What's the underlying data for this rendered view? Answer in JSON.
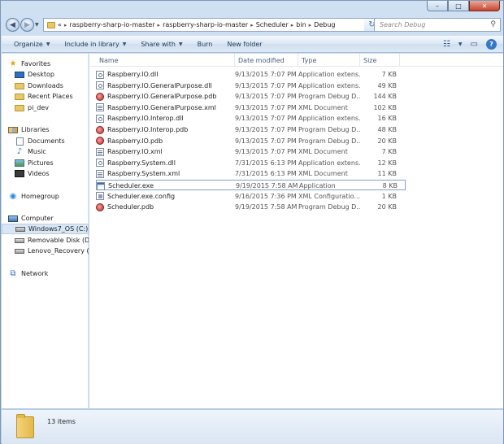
{
  "window": {
    "controls": {
      "minimize": "–",
      "maximize": "□",
      "close": "✕"
    }
  },
  "address": {
    "prefix": "«",
    "crumbs": [
      "raspberry-sharp-io-master",
      "raspberry-sharp-io-master",
      "Scheduler",
      "bin",
      "Debug"
    ],
    "separator": "▸"
  },
  "search": {
    "placeholder": "Search Debug"
  },
  "toolbar": {
    "organize": "Organize",
    "include_in_library": "Include in library",
    "share_with": "Share with",
    "burn": "Burn",
    "new_folder": "New folder"
  },
  "nav": {
    "favorites": {
      "label": "Favorites",
      "items": [
        "Desktop",
        "Downloads",
        "Recent Places",
        "pi_dev"
      ]
    },
    "libraries": {
      "label": "Libraries",
      "items": [
        "Documents",
        "Music",
        "Pictures",
        "Videos"
      ]
    },
    "homegroup": "Homegroup",
    "computer": {
      "label": "Computer",
      "items": [
        "Windows7_OS (C:)",
        "Removable Disk (D:)",
        "Lenovo_Recovery (Q:)"
      ]
    },
    "network": "Network"
  },
  "columns": {
    "name": "Name",
    "date": "Date modified",
    "type": "Type",
    "size": "Size"
  },
  "files": [
    {
      "name": "Raspberry.IO.dll",
      "date": "9/13/2015 7:07 PM",
      "type": "Application extens...",
      "size": "7 KB",
      "kind": "dll"
    },
    {
      "name": "Raspberry.IO.GeneralPurpose.dll",
      "date": "9/13/2015 7:07 PM",
      "type": "Application extens...",
      "size": "49 KB",
      "kind": "dll"
    },
    {
      "name": "Raspberry.IO.GeneralPurpose.pdb",
      "date": "9/13/2015 7:07 PM",
      "type": "Program Debug D...",
      "size": "144 KB",
      "kind": "pdb"
    },
    {
      "name": "Raspberry.IO.GeneralPurpose.xml",
      "date": "9/13/2015 7:07 PM",
      "type": "XML Document",
      "size": "102 KB",
      "kind": "xml"
    },
    {
      "name": "Raspberry.IO.Interop.dll",
      "date": "9/13/2015 7:07 PM",
      "type": "Application extens...",
      "size": "16 KB",
      "kind": "dll"
    },
    {
      "name": "Raspberry.IO.Interop.pdb",
      "date": "9/13/2015 7:07 PM",
      "type": "Program Debug D...",
      "size": "48 KB",
      "kind": "pdb"
    },
    {
      "name": "Raspberry.IO.pdb",
      "date": "9/13/2015 7:07 PM",
      "type": "Program Debug D...",
      "size": "20 KB",
      "kind": "pdb"
    },
    {
      "name": "Raspberry.IO.xml",
      "date": "9/13/2015 7:07 PM",
      "type": "XML Document",
      "size": "7 KB",
      "kind": "xml"
    },
    {
      "name": "Raspberry.System.dll",
      "date": "7/31/2015 6:13 PM",
      "type": "Application extens...",
      "size": "12 KB",
      "kind": "dll"
    },
    {
      "name": "Raspberry.System.xml",
      "date": "7/31/2015 6:13 PM",
      "type": "XML Document",
      "size": "11 KB",
      "kind": "xml"
    },
    {
      "name": "Scheduler.exe",
      "date": "9/19/2015 7:58 AM",
      "type": "Application",
      "size": "8 KB",
      "kind": "exe",
      "selected": true
    },
    {
      "name": "Scheduler.exe.config",
      "date": "9/16/2015 7:36 PM",
      "type": "XML Configuratio...",
      "size": "1 KB",
      "kind": "config"
    },
    {
      "name": "Scheduler.pdb",
      "date": "9/19/2015 7:58 AM",
      "type": "Program Debug D...",
      "size": "20 KB",
      "kind": "pdb"
    }
  ],
  "status": {
    "count": "13 items"
  }
}
